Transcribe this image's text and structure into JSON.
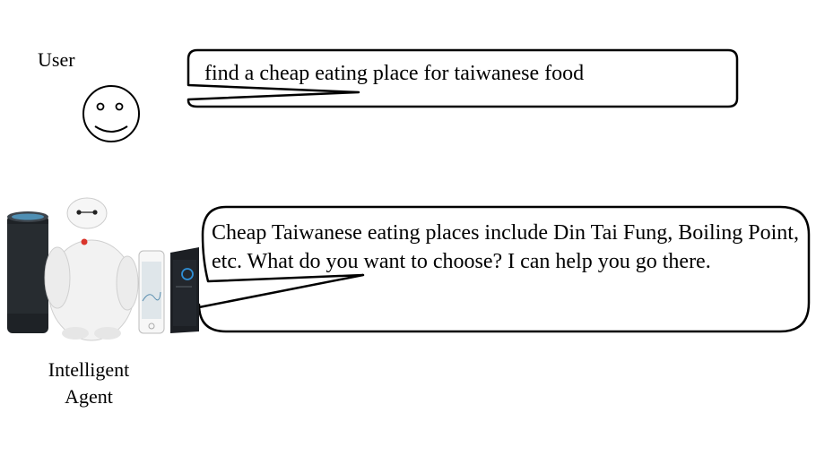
{
  "user": {
    "label": "User",
    "message": "find a cheap eating place for taiwanese food"
  },
  "agent": {
    "label_line1": "Intelligent",
    "label_line2": "Agent",
    "message": "Cheap Taiwanese eating places include Din Tai Fung, Boiling Point, etc. What do you want to choose? I can help you go there."
  },
  "icons": [
    "smiley-face-icon",
    "smart-speaker-icon",
    "robot-icon",
    "smartphone-icon",
    "tablet-icon"
  ]
}
